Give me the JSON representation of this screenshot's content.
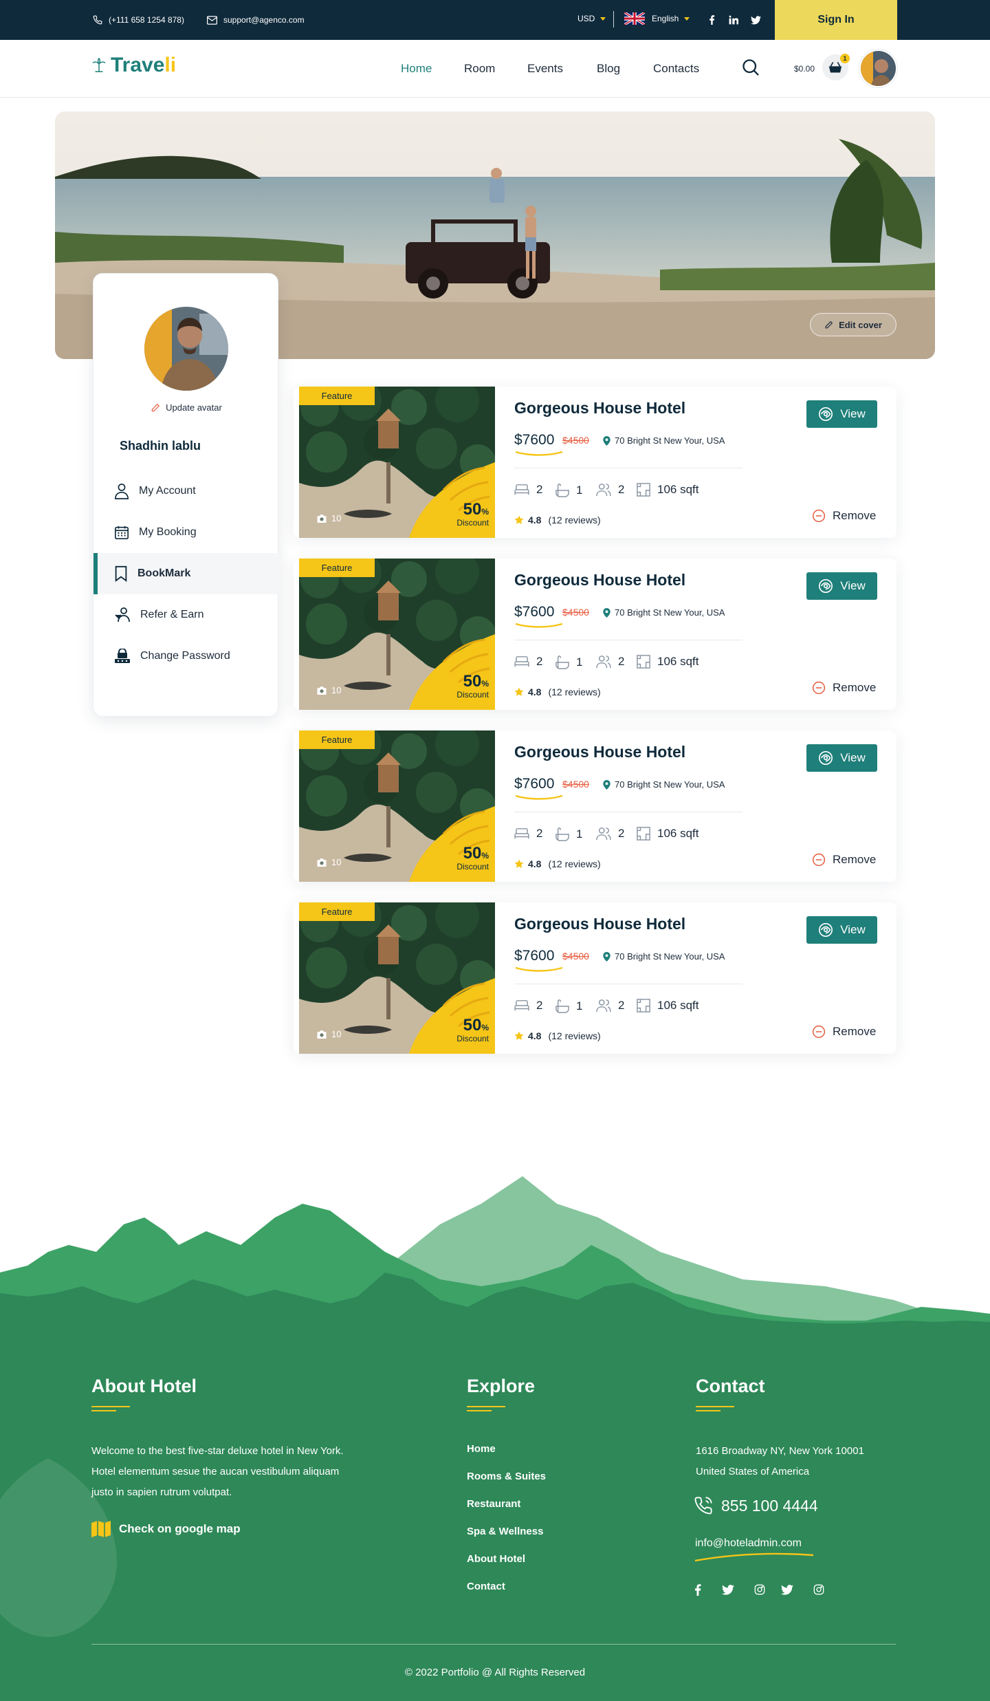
{
  "topbar": {
    "phone": "(+111 658 1254 878)",
    "email": "support@agenco.com",
    "currency": "USD",
    "language": "English",
    "signin_label": "Sign In"
  },
  "nav": {
    "logo_main": "Trave",
    "logo_tail": "li",
    "items": [
      "Home",
      "Room",
      "Events",
      "Blog",
      "Contacts"
    ],
    "active": "Home",
    "cart_total": "$0.00",
    "cart_count": "1"
  },
  "cover": {
    "edit_label": "Edit cover"
  },
  "sidebar": {
    "update_avatar": "Update avatar",
    "name": "Shadhin lablu",
    "menu": [
      {
        "label": "My Account",
        "icon": "user-icon"
      },
      {
        "label": "My Booking",
        "icon": "calendar-icon"
      },
      {
        "label": "BookMark",
        "icon": "bookmark-icon"
      },
      {
        "label": "Refer & Earn",
        "icon": "refer-icon"
      },
      {
        "label": "Change Password",
        "icon": "lock-icon"
      }
    ],
    "active": "BookMark"
  },
  "cards": [
    {
      "tag": "Feature",
      "photos": "10",
      "discount": "50",
      "discount_unit": "%",
      "discount_label": "Discount",
      "title": "Gorgeous House Hotel",
      "price": "$7600",
      "old_price": "$4500",
      "address": "70 Bright St New Your, USA",
      "beds": "2",
      "baths": "1",
      "guests": "2",
      "area": "106 sqft",
      "rating": "4.8",
      "reviews": "(12 reviews)",
      "view_label": "View",
      "remove_label": "Remove"
    },
    {
      "tag": "Feature",
      "photos": "10",
      "discount": "50",
      "discount_unit": "%",
      "discount_label": "Discount",
      "title": "Gorgeous House Hotel",
      "price": "$7600",
      "old_price": "$4500",
      "address": "70 Bright St New Your, USA",
      "beds": "2",
      "baths": "1",
      "guests": "2",
      "area": "106 sqft",
      "rating": "4.8",
      "reviews": "(12 reviews)",
      "view_label": "View",
      "remove_label": "Remove"
    },
    {
      "tag": "Feature",
      "photos": "10",
      "discount": "50",
      "discount_unit": "%",
      "discount_label": "Discount",
      "title": "Gorgeous House Hotel",
      "price": "$7600",
      "old_price": "$4500",
      "address": "70 Bright St New Your, USA",
      "beds": "2",
      "baths": "1",
      "guests": "2",
      "area": "106 sqft",
      "rating": "4.8",
      "reviews": "(12 reviews)",
      "view_label": "View",
      "remove_label": "Remove"
    },
    {
      "tag": "Feature",
      "photos": "10",
      "discount": "50",
      "discount_unit": "%",
      "discount_label": "Discount",
      "title": "Gorgeous House Hotel",
      "price": "$7600",
      "old_price": "$4500",
      "address": "70 Bright St New Your, USA",
      "beds": "2",
      "baths": "1",
      "guests": "2",
      "area": "106 sqft",
      "rating": "4.8",
      "reviews": "(12 reviews)",
      "view_label": "View",
      "remove_label": "Remove"
    }
  ],
  "footer": {
    "about_heading": "About Hotel",
    "about_text": "Welcome to the best five-star deluxe hotel in New York. Hotel elementum sesue the aucan vestibulum aliquam justo in sapien rutrum volutpat.",
    "map_link": "Check on google map",
    "explore_heading": "Explore",
    "explore_links": [
      "Home",
      "Rooms & Suites",
      "Restaurant",
      "Spa & Wellness",
      "About Hotel",
      "Contact"
    ],
    "contact_heading": "Contact",
    "address_line1": "1616 Broadway NY, New York 10001",
    "address_line2": "United States of America",
    "phone": "855 100 4444",
    "email": "info@hoteladmin.com",
    "social_icons": [
      "facebook-icon",
      "twitter-icon",
      "instagram-icon",
      "twitter-icon",
      "instagram-icon"
    ],
    "copyright": "© 2022 Portfolio @ All Rights Reserved"
  },
  "colors": {
    "topbar": "#0f2a3b",
    "accent": "#1f7f7a",
    "yellow": "#f5c518",
    "signin": "#ecd85a",
    "footer": "#2e8858",
    "sale": "#e65b3e"
  }
}
